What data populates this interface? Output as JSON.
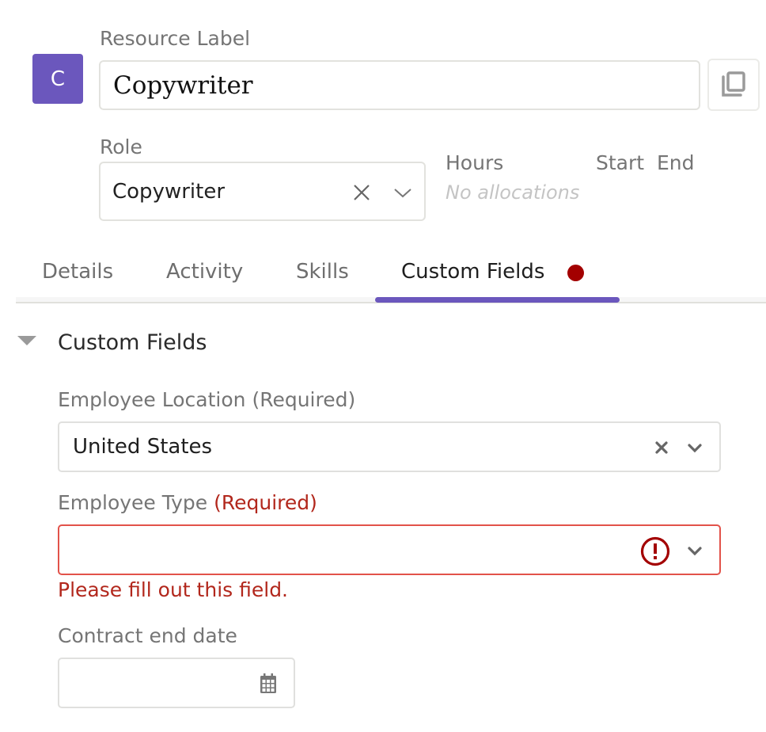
{
  "resource": {
    "avatar_initial": "C",
    "avatar_color": "#6b57bd",
    "label_title": "Resource Label",
    "label_value": "Copywriter",
    "copy_icon": "copy-icon"
  },
  "role": {
    "title": "Role",
    "value": "Copywriter",
    "clear_icon": "close-icon",
    "dropdown_icon": "chevron-down-icon"
  },
  "allocations": {
    "hours_label": "Hours",
    "start_label": "Start",
    "end_label": "End",
    "empty_text": "No allocations"
  },
  "tabs": [
    {
      "label": "Details",
      "active": false
    },
    {
      "label": "Activity",
      "active": false
    },
    {
      "label": "Skills",
      "active": false
    },
    {
      "label": "Custom Fields",
      "active": true,
      "has_error_dot": true
    }
  ],
  "colors": {
    "accent": "#6b57bd",
    "error": "#b2271c",
    "error_dot": "#a30000",
    "error_border": "#e2524a"
  },
  "custom_fields": {
    "section_title": "Custom Fields",
    "expanded": true,
    "employee_location": {
      "label": "Employee Location (Required)",
      "value": "United States"
    },
    "employee_type": {
      "label": "Employee Type",
      "required_text": "(Required)",
      "value": "",
      "error_message": "Please fill out this field."
    },
    "contract_end_date": {
      "label": "Contract end date",
      "value": ""
    }
  }
}
